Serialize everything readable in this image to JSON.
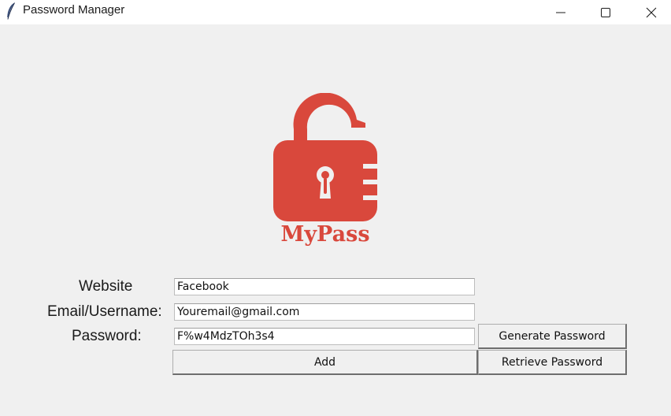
{
  "window": {
    "title": "Password Manager",
    "icon": "feather-icon",
    "controls": [
      "minimize-icon",
      "maximize-icon",
      "close-icon"
    ]
  },
  "logo": {
    "text": "MyPass",
    "icon": "open-padlock-icon",
    "color": "#d9483c"
  },
  "form": {
    "website_label": "Website",
    "website_value": "Facebook",
    "email_label": "Email/Username:",
    "email_value": "Youremail@gmail.com",
    "password_label": "Password:",
    "password_value": "F%w4MdzTOh3s4"
  },
  "buttons": {
    "generate": "Generate Password",
    "add": "Add",
    "retrieve": "Retrieve Password"
  }
}
